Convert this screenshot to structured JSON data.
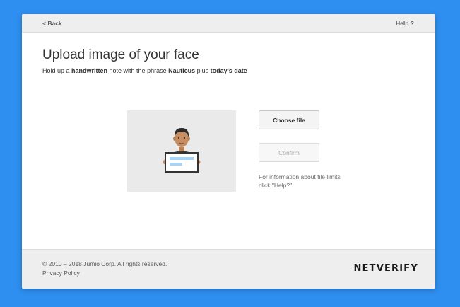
{
  "header": {
    "back_label": "< Back",
    "help_label": "Help ?"
  },
  "main": {
    "title": "Upload image of your face",
    "subtitle": {
      "part1": "Hold up a ",
      "bold1": "handwritten",
      "part2": " note with the phrase ",
      "bold2": "Nauticus",
      "part3": " plus ",
      "bold3": "today's date"
    },
    "illustration_icon": "person-holding-note-icon",
    "choose_file_label": "Choose file",
    "confirm_label": "Confirm",
    "info_text": "For information about file limits click \"Help?\""
  },
  "footer": {
    "copyright": "© 2010 – 2018 Jumio Corp. All rights reserved.",
    "privacy_label": "Privacy Policy",
    "brand": "NETVERIFY"
  },
  "colors": {
    "background": "#2e8ff0",
    "card": "#ffffff",
    "bars": "#eeeeee",
    "note_lines": "#a9d3f5"
  }
}
